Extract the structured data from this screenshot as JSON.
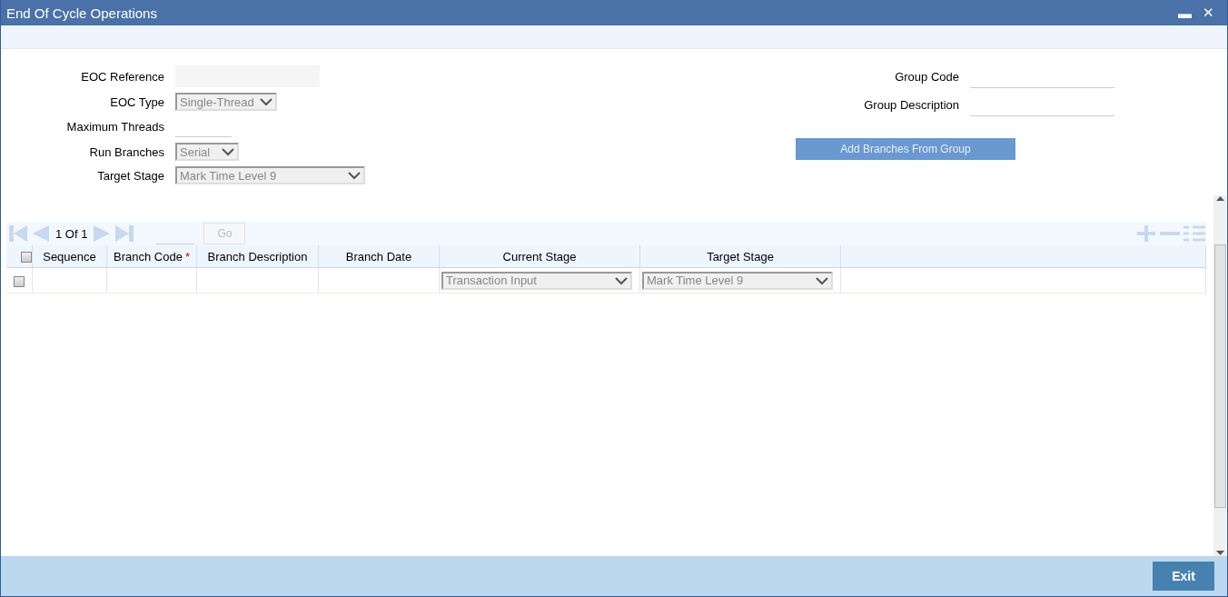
{
  "window": {
    "title": "End Of Cycle Operations",
    "minimize": "▬",
    "close": "✕"
  },
  "form_left": [
    {
      "label": "EOC Reference",
      "kind": "text"
    },
    {
      "label": "EOC Type",
      "kind": "select",
      "value": "Single-Thread",
      "disabled": true
    },
    {
      "label": "Maximum Threads",
      "kind": "line"
    },
    {
      "label": "Run Branches",
      "kind": "select",
      "value": "Serial",
      "disabled": true
    },
    {
      "label": "Target Stage",
      "kind": "select",
      "value": "Mark Time Level 9",
      "disabled": true
    }
  ],
  "form_right": [
    {
      "label": "Group Code",
      "kind": "line"
    },
    {
      "label": "Group Description",
      "kind": "line"
    }
  ],
  "add_button": {
    "label": "Add Branches From Group",
    "disabled": true
  },
  "pager": {
    "page": "1",
    "of": "Of",
    "total": "1",
    "go": "Go"
  },
  "table": {
    "select_all": {
      "checked": false
    },
    "columns": [
      {
        "label": "Sequence",
        "required": false
      },
      {
        "label": "Branch Code",
        "required": true,
        "required_mark": "*"
      },
      {
        "label": "Branch Description",
        "required": false
      },
      {
        "label": "Branch Date",
        "required": false
      },
      {
        "label": "Current Stage",
        "required": false
      },
      {
        "label": "Target Stage",
        "required": false
      }
    ],
    "rows": [
      {
        "checked": false,
        "current_stage": "Transaction Input",
        "target_stage": "Mark Time Level 9"
      }
    ]
  },
  "footer": {
    "exit": "Exit"
  }
}
